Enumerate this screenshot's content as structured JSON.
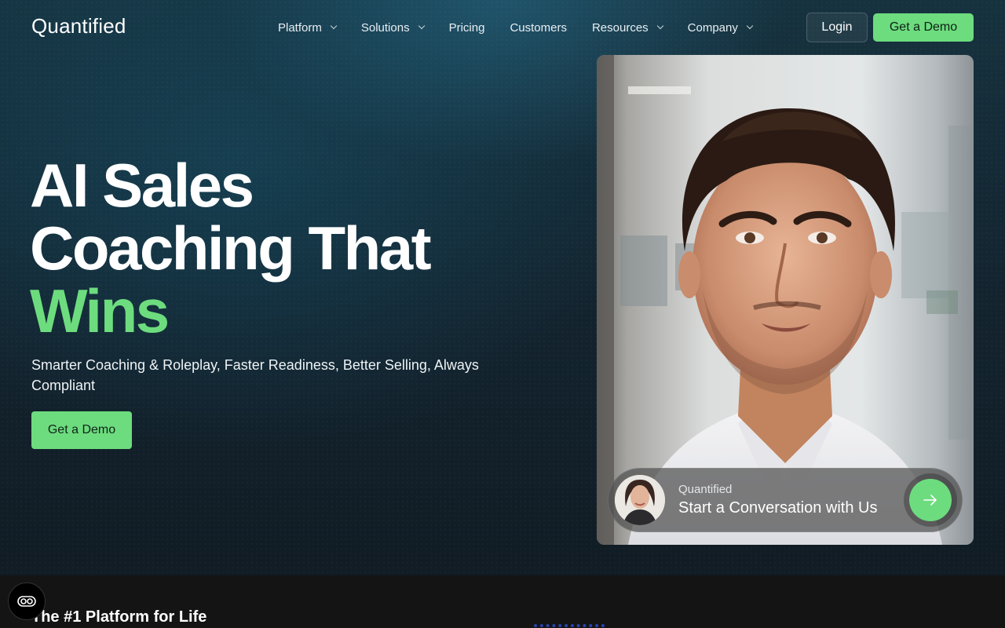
{
  "brand": {
    "logo_text": "Quantified"
  },
  "nav": {
    "items": [
      {
        "label": "Platform",
        "has_dropdown": true
      },
      {
        "label": "Solutions",
        "has_dropdown": true
      },
      {
        "label": "Pricing",
        "has_dropdown": false
      },
      {
        "label": "Customers",
        "has_dropdown": false
      },
      {
        "label": "Resources",
        "has_dropdown": true
      },
      {
        "label": "Company",
        "has_dropdown": true
      }
    ],
    "login_label": "Login",
    "demo_label": "Get a Demo"
  },
  "hero": {
    "headline_line1": "AI Sales",
    "headline_line2": "Coaching That",
    "headline_accent": "Wins",
    "subtitle": "Smarter Coaching & Roleplay, Faster Readiness, Better Selling, Always Compliant",
    "cta_label": "Get a Demo"
  },
  "video_card": {
    "cta_brand": "Quantified",
    "cta_text": "Start a Conversation with Us",
    "arrow_icon": "arrow-right-icon"
  },
  "next_section": {
    "title": "The #1 Platform for Life"
  },
  "colors": {
    "accent": "#6ddc7e",
    "background": "#0f1a22",
    "bottom_bg": "#141414"
  },
  "floating": {
    "cookie_icon": "cookie-consent-icon"
  }
}
